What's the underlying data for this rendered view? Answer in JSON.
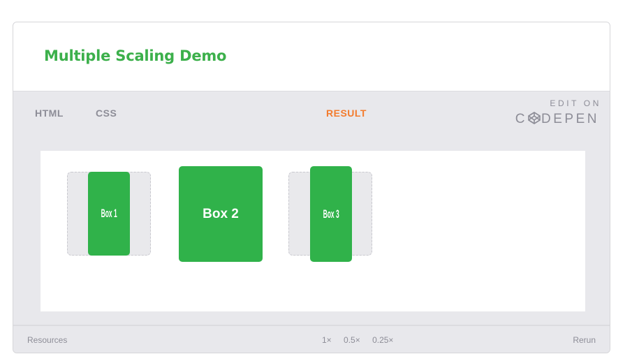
{
  "header": {
    "title": "Multiple Scaling Demo"
  },
  "tabs": [
    {
      "label": "HTML"
    },
    {
      "label": "CSS"
    },
    {
      "label": "RESULT"
    }
  ],
  "codepen": {
    "edit_on": "EDIT ON",
    "brand_prefix": "C",
    "brand_suffix": "DEPEN"
  },
  "result": {
    "boxes": [
      {
        "label": "Box 1"
      },
      {
        "label": "Box 2"
      },
      {
        "label": "Box 3"
      }
    ]
  },
  "footer": {
    "resources_label": "Resources",
    "scales": [
      "1×",
      "0.5×",
      "0.25×"
    ],
    "rerun_label": "Rerun"
  },
  "colors": {
    "title_green": "#3cb04b",
    "box_green": "#30b24a",
    "active_tab_orange": "#f37b2d",
    "muted_gray": "#8d8d97"
  }
}
